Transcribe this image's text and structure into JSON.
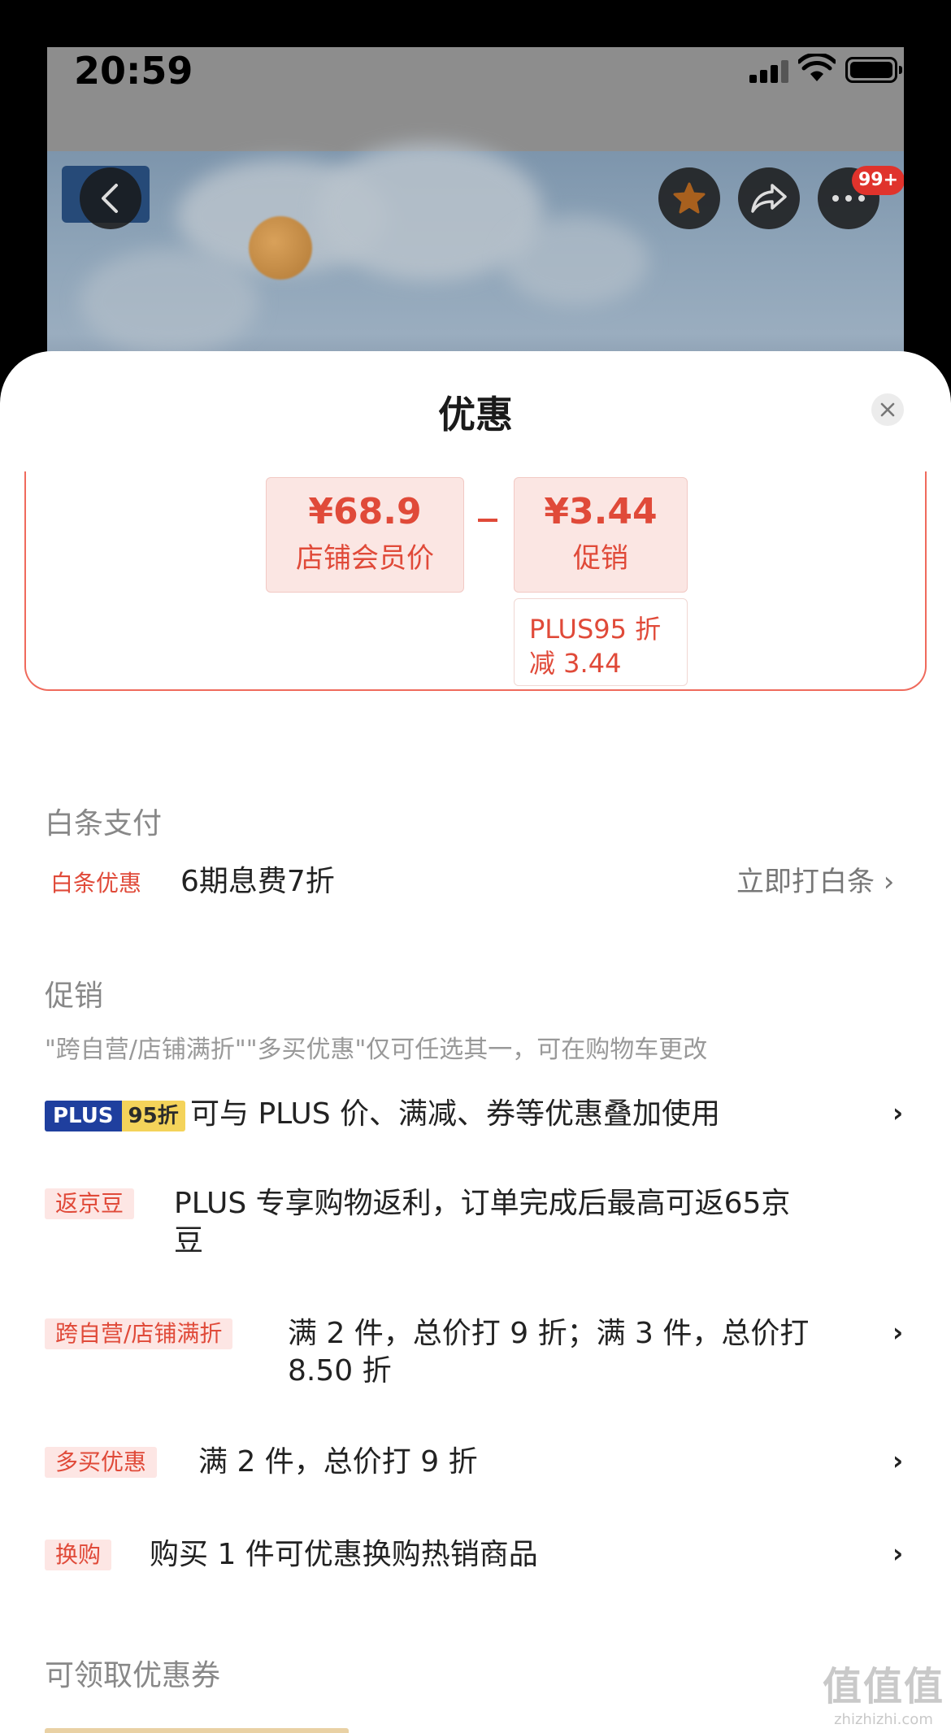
{
  "status_bar": {
    "time": "20:59"
  },
  "header_icons": {
    "back": "chevron-left-icon",
    "star": "star-icon",
    "share": "share-icon",
    "more": "more-icon",
    "more_badge": "99+"
  },
  "sheet": {
    "title": "优惠",
    "close_icon": "close-icon"
  },
  "price_breakdown": {
    "member_price": "¥68.9",
    "member_price_label": "店铺会员价",
    "promo_amount": "¥3.44",
    "promo_label": "促销",
    "plus_detail_line1": "PLUS95 折",
    "plus_detail_line2": "减 3.44"
  },
  "baitiao": {
    "section_title": "白条支付",
    "tag": "白条优惠",
    "desc": "6期息费7折",
    "action": "立即打白条 ›"
  },
  "promotions": {
    "section_title": "促销",
    "note": "\"跨自营/店铺满折\"\"多买优惠\"仅可任选其一，可在购物车更改",
    "plus_badge_left": "PLUS",
    "plus_badge_right": "95折",
    "plus_desc": "可与 PLUS 价、满减、券等优惠叠加使用",
    "rows": [
      {
        "tag": "返京豆",
        "desc_line1": "PLUS 专享购物返利，订单完成后最高可返65京",
        "desc_line2": "豆"
      },
      {
        "tag": "跨自营/店铺满折",
        "desc_line1": "满 2 件，总价打 9 折；满 3 件，总价打",
        "desc_line2": "8.50 折"
      },
      {
        "tag": "多买优惠",
        "desc_line1": "满 2 件，总价打 9 折"
      },
      {
        "tag": "换购",
        "desc_line1": "购买 1 件可优惠换购热销商品"
      }
    ],
    "chevron": "›"
  },
  "coupons": {
    "section_title": "可领取优惠券"
  },
  "watermark": {
    "big": "值值值",
    "small": "zhizhizhi.com"
  },
  "colors": {
    "accent": "#e04a39",
    "tag_bg": "#fde6e4",
    "plus_blue": "#1f3f9e",
    "plus_gold": "#f4d35a"
  }
}
